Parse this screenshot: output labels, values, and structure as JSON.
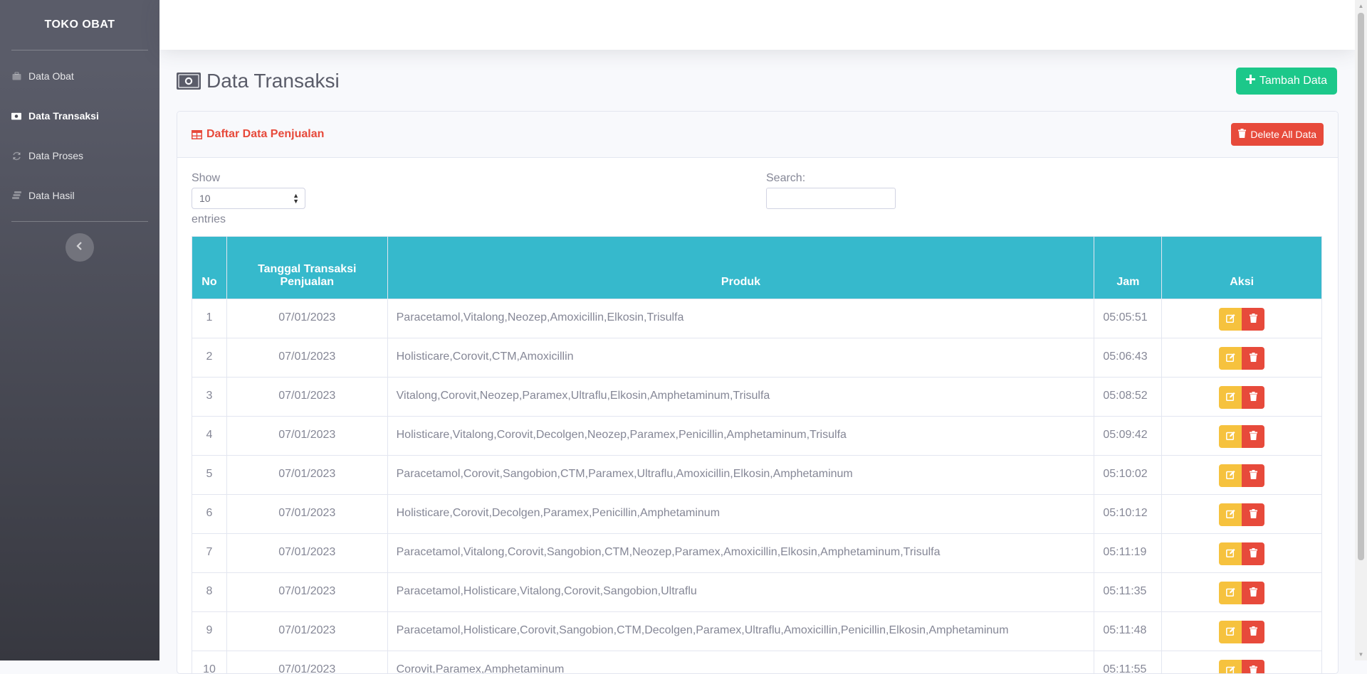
{
  "sidebar": {
    "brand": "TOKO OBAT",
    "items": [
      {
        "label": "Data Obat",
        "icon": "briefcase-icon",
        "active": false
      },
      {
        "label": "Data Transaksi",
        "icon": "money-bill-icon",
        "active": true
      },
      {
        "label": "Data Proses",
        "icon": "sync-icon",
        "active": false
      },
      {
        "label": "Data Hasil",
        "icon": "database-icon",
        "active": false
      }
    ],
    "toggle_icon": "chevron-left-icon"
  },
  "page": {
    "title": "Data Transaksi",
    "title_icon": "money-bill-icon",
    "add_button": "Tambah Data"
  },
  "card": {
    "title": "Daftar Data Penjualan",
    "delete_all_button": "Delete All Data"
  },
  "table_controls": {
    "show_label": "Show",
    "show_value": "10",
    "entries_label": "entries",
    "search_label": "Search:",
    "search_value": ""
  },
  "table": {
    "headers": {
      "no": "No",
      "date_line1": "Tanggal Transaksi",
      "date_line2": "Penjualan",
      "product": "Produk",
      "time": "Jam",
      "action": "Aksi"
    },
    "rows": [
      {
        "no": "1",
        "date": "07/01/2023",
        "product": "Paracetamol,Vitalong,Neozep,Amoxicillin,Elkosin,Trisulfa",
        "time": "05:05:51"
      },
      {
        "no": "2",
        "date": "07/01/2023",
        "product": "Holisticare,Corovit,CTM,Amoxicillin",
        "time": "05:06:43"
      },
      {
        "no": "3",
        "date": "07/01/2023",
        "product": "Vitalong,Corovit,Neozep,Paramex,Ultraflu,Elkosin,Amphetaminum,Trisulfa",
        "time": "05:08:52"
      },
      {
        "no": "4",
        "date": "07/01/2023",
        "product": "Holisticare,Vitalong,Corovit,Decolgen,Neozep,Paramex,Penicillin,Amphetaminum,Trisulfa",
        "time": "05:09:42"
      },
      {
        "no": "5",
        "date": "07/01/2023",
        "product": "Paracetamol,Corovit,Sangobion,CTM,Paramex,Ultraflu,Amoxicillin,Elkosin,Amphetaminum",
        "time": "05:10:02"
      },
      {
        "no": "6",
        "date": "07/01/2023",
        "product": "Holisticare,Corovit,Decolgen,Paramex,Penicillin,Amphetaminum",
        "time": "05:10:12"
      },
      {
        "no": "7",
        "date": "07/01/2023",
        "product": "Paracetamol,Vitalong,Corovit,Sangobion,CTM,Neozep,Paramex,Amoxicillin,Elkosin,Amphetaminum,Trisulfa",
        "time": "05:11:19"
      },
      {
        "no": "8",
        "date": "07/01/2023",
        "product": "Paracetamol,Holisticare,Vitalong,Corovit,Sangobion,Ultraflu",
        "time": "05:11:35"
      },
      {
        "no": "9",
        "date": "07/01/2023",
        "product": "Paracetamol,Holisticare,Corovit,Sangobion,CTM,Decolgen,Paramex,Ultraflu,Amoxicillin,Penicillin,Elkosin,Amphetaminum",
        "time": "05:11:48"
      },
      {
        "no": "10",
        "date": "07/01/2023",
        "product": "Corovit,Paramex,Amphetaminum",
        "time": "05:11:55"
      }
    ]
  },
  "colors": {
    "sidebar_top": "#5a5c69",
    "sidebar_bottom": "#373840",
    "success": "#1cc88a",
    "danger": "#e74a3b",
    "warning": "#f6c23e",
    "info": "#36b9cc"
  }
}
